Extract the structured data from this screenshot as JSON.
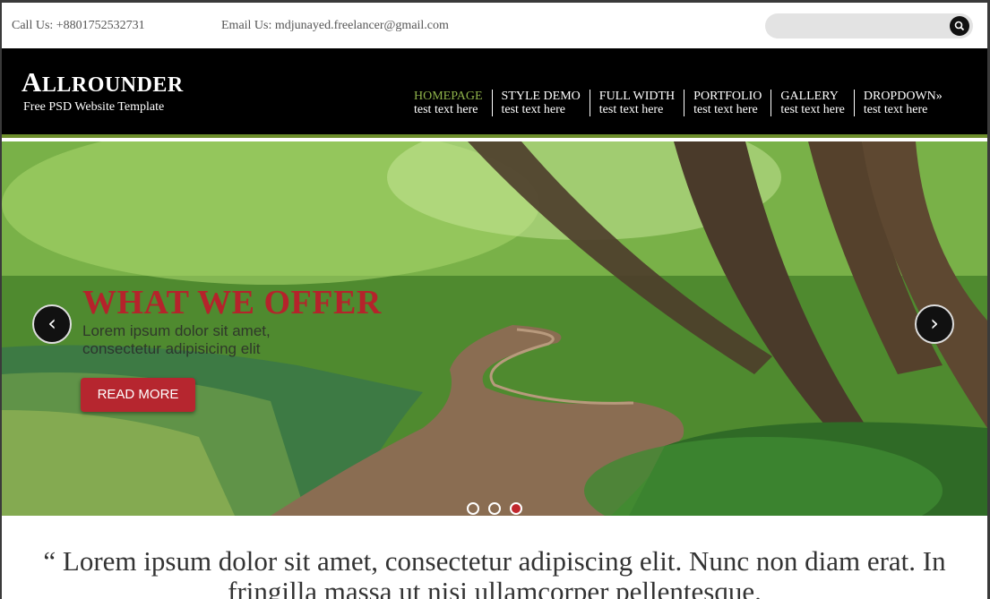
{
  "topbar": {
    "call": "Call Us: +8801752532731",
    "email": "Email Us: mdjunayed.freelancer@gmail.com",
    "search_placeholder": ""
  },
  "header": {
    "logo_first": "A",
    "logo_rest": "LLROUNDER",
    "tagline": "Free PSD Website Template"
  },
  "nav": [
    {
      "title": "HOMEPAGE",
      "sub": "test text here",
      "active": true
    },
    {
      "title": "STYLE DEMO",
      "sub": "test text here"
    },
    {
      "title": "FULL WIDTH",
      "sub": "test text here"
    },
    {
      "title": "PORTFOLIO",
      "sub": "test text here"
    },
    {
      "title": "GALLERY",
      "sub": "test text here"
    },
    {
      "title": "DROPDOWN»",
      "sub": "test text here"
    }
  ],
  "slider": {
    "title": "WHAT WE OFFER",
    "text": "Lorem ipsum dolor sit amet, consectetur adipisicing elit",
    "button": "READ MORE",
    "prev_icon": "‹",
    "next_icon": "›",
    "slides_total": 3,
    "active_slide": 3
  },
  "quote": "“ Lorem ipsum dolor sit amet, consectetur adipiscing elit. Nunc non diam erat. In fringilla massa ut nisi ullamcorper pellentesque.",
  "colors": {
    "accent_green": "#8fb34a",
    "accent_red": "#b6262f",
    "header_bg": "#000000"
  }
}
